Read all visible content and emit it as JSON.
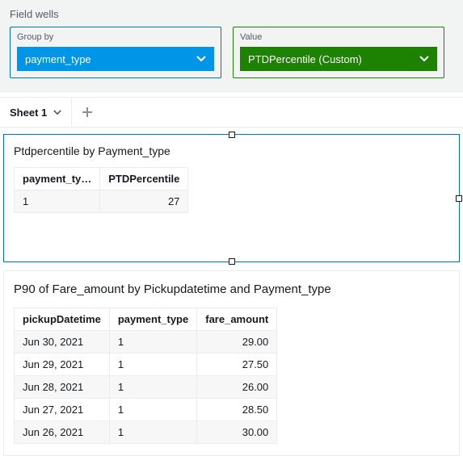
{
  "fieldWells": {
    "title": "Field wells",
    "groupBy": {
      "label": "Group by",
      "value": "payment_type"
    },
    "value": {
      "label": "Value",
      "value": "PTDPercentile (Custom)"
    }
  },
  "sheets": {
    "active": "Sheet 1"
  },
  "viz1": {
    "title": "Ptdpercentile by Payment_type",
    "columns": [
      "payment_ty…",
      "PTDPercentile"
    ],
    "rows": [
      {
        "c0": "1",
        "c1": "27"
      }
    ]
  },
  "viz2": {
    "title": "P90 of Fare_amount by Pickupdatetime and Payment_type",
    "columns": [
      "pickupDatetime",
      "payment_type",
      "fare_amount"
    ],
    "rows": [
      {
        "c0": "Jun 30, 2021",
        "c1": "1",
        "c2": "29.00"
      },
      {
        "c0": "Jun 29, 2021",
        "c1": "1",
        "c2": "27.50"
      },
      {
        "c0": "Jun 28, 2021",
        "c1": "1",
        "c2": "26.00"
      },
      {
        "c0": "Jun 27, 2021",
        "c1": "1",
        "c2": "28.50"
      },
      {
        "c0": "Jun 26, 2021",
        "c1": "1",
        "c2": "30.00"
      }
    ]
  },
  "chart_data": [
    {
      "type": "table",
      "title": "Ptdpercentile by Payment_type",
      "columns": [
        "payment_type",
        "PTDPercentile"
      ],
      "rows": [
        [
          "1",
          27
        ]
      ]
    },
    {
      "type": "table",
      "title": "P90 of Fare_amount by Pickupdatetime and Payment_type",
      "columns": [
        "pickupDatetime",
        "payment_type",
        "fare_amount"
      ],
      "rows": [
        [
          "Jun 30, 2021",
          "1",
          29.0
        ],
        [
          "Jun 29, 2021",
          "1",
          27.5
        ],
        [
          "Jun 28, 2021",
          "1",
          26.0
        ],
        [
          "Jun 27, 2021",
          "1",
          28.5
        ],
        [
          "Jun 26, 2021",
          "1",
          30.0
        ]
      ]
    }
  ],
  "colors": {
    "blue": "#0073bb",
    "blueFill": "#0095e6",
    "green": "#1d8102"
  }
}
